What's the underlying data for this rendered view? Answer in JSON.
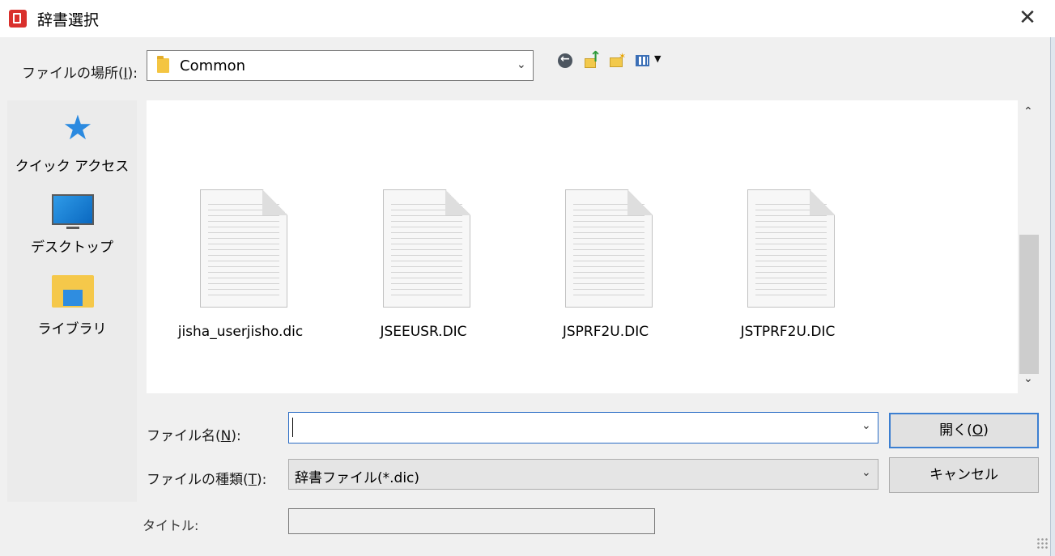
{
  "window": {
    "title": "辞書選択",
    "close_glyph": "✕"
  },
  "toolbar": {
    "look_in_label": "ファイルの場所(I):",
    "look_in_mnemonic": "I",
    "look_in_value": "Common",
    "icons": [
      "back-icon",
      "up-folder-icon",
      "new-folder-icon",
      "view-menu-icon"
    ]
  },
  "places": [
    {
      "label": "クイック アクセス",
      "icon": "star-icon"
    },
    {
      "label": "デスクトップ",
      "icon": "desktop-icon"
    },
    {
      "label": "ライブラリ",
      "icon": "library-icon"
    }
  ],
  "files": [
    {
      "name": "jisha_userjisho.dic"
    },
    {
      "name": "JSEEUSR.DIC"
    },
    {
      "name": "JSPRF2U.DIC"
    },
    {
      "name": "JSTPRF2U.DIC"
    }
  ],
  "form": {
    "file_name_label_pre": "ファイル名(",
    "file_name_mnemonic": "N",
    "file_name_label_post": "):",
    "file_name_value": "",
    "file_type_label_pre": "ファイルの種類(",
    "file_type_mnemonic": "T",
    "file_type_label_post": "):",
    "file_type_value": "辞書ファイル(*.dic)",
    "title_label": "タイトル:",
    "title_value": ""
  },
  "buttons": {
    "open_pre": "開く(",
    "open_mnemonic": "O",
    "open_post": ")",
    "cancel": "キャンセル"
  },
  "colors": {
    "accent": "#2a6cc5",
    "app_icon": "#d9302c",
    "folder": "#f4c542"
  }
}
